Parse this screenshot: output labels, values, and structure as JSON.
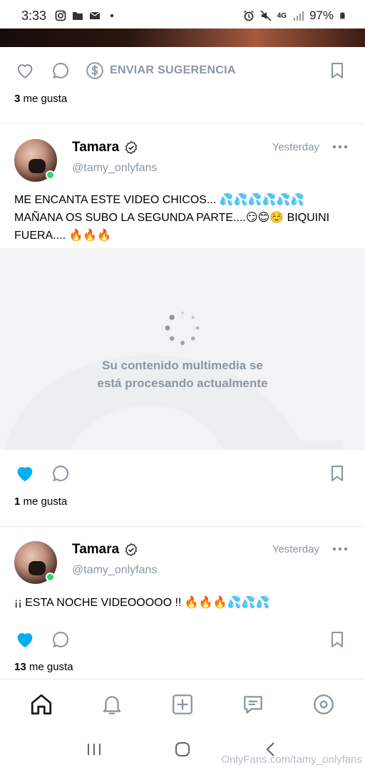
{
  "status_bar": {
    "time": "3:33",
    "network": "4G",
    "battery": "97%",
    "icons_left": [
      "instagram-icon",
      "folder-icon",
      "mail-icon",
      "dot-icon"
    ],
    "icons_right": [
      "alarm-icon",
      "mute-icon",
      "signal-icon",
      "battery-icon"
    ]
  },
  "top_post": {
    "tip_label": "ENVIAR SUGERENCIA",
    "likes_count": "3",
    "likes_suffix": "me gusta"
  },
  "posts": [
    {
      "author": "Tamara",
      "handle": "@tamy_onlyfans",
      "time": "Yesterday",
      "text": "ME ENCANTA ESTE VIDEO CHICOS... 💦💦💦💦💦💦 MAÑANA OS SUBO LA SEGUNDA PARTE....😏😊☺️ BIQUINI FUERA.... 🔥🔥🔥",
      "media_status": "Su contenido multimedia se está procesando actualmente",
      "liked": true,
      "likes_count": "1",
      "likes_suffix": "me gusta"
    },
    {
      "author": "Tamara",
      "handle": "@tamy_onlyfans",
      "time": "Yesterday",
      "text": "¡¡ ESTA NOCHE VIDEOOOOO !! 🔥🔥🔥💦💦💦",
      "liked": true,
      "likes_count": "13",
      "likes_suffix": "me gusta"
    }
  ],
  "bottom_nav": [
    "home-icon",
    "bell-icon",
    "add-post-icon",
    "messages-icon",
    "profile-icon"
  ],
  "watermark": "OnlyFans.com/tamy_onlyfans",
  "colors": {
    "accent": "#00aff0",
    "muted": "#8a96a3",
    "online": "#2ed573"
  }
}
